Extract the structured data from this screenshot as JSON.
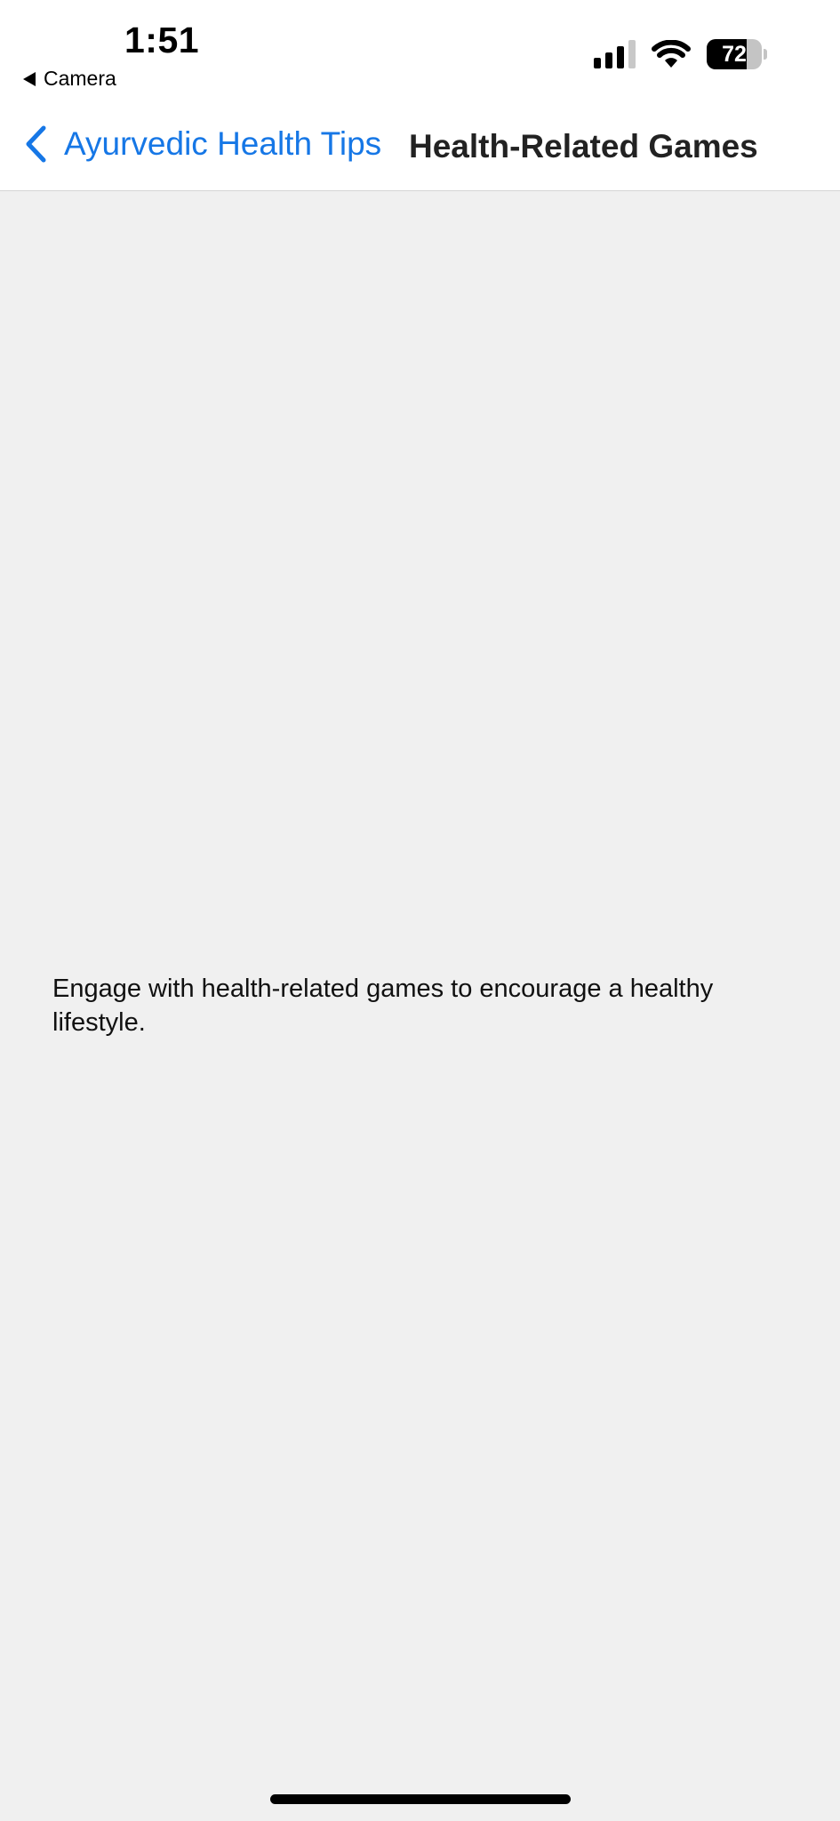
{
  "status_bar": {
    "time": "1:51",
    "back_app_label": "Camera",
    "signal_bars_active": 3,
    "signal_bars_total": 4,
    "wifi": true,
    "battery_level": "72"
  },
  "nav": {
    "back_label": "Ayurvedic Health Tips",
    "title": "Health-Related Games"
  },
  "content": {
    "description": "Engage with health-related games to encourage a healthy lifestyle."
  },
  "colors": {
    "accent": "#1677e6",
    "background": "#f0f0f0",
    "header_background": "#ffffff"
  },
  "icons": {
    "back": "chevron-left-icon",
    "camera_back": "triangle-left-icon",
    "signal": "cellular-signal-icon",
    "wifi": "wifi-icon",
    "battery": "battery-icon"
  }
}
